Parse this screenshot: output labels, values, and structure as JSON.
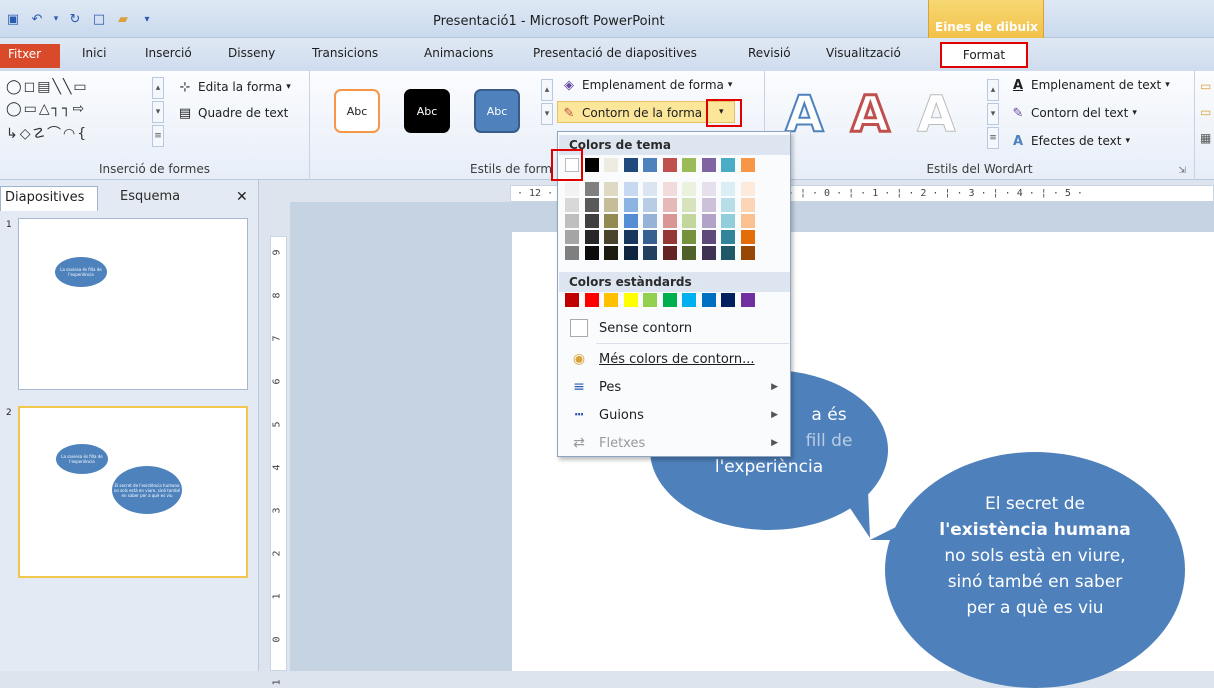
{
  "window": {
    "title": "Presentació1 - Microsoft PowerPoint",
    "context_tab_label": "Eines de dibuix"
  },
  "tabs": [
    {
      "label": "Fitxer"
    },
    {
      "label": "Inici"
    },
    {
      "label": "Inserció"
    },
    {
      "label": "Disseny"
    },
    {
      "label": "Transicions"
    },
    {
      "label": "Animacions"
    },
    {
      "label": "Presentació de diapositives"
    },
    {
      "label": "Revisió"
    },
    {
      "label": "Visualització"
    },
    {
      "label": "Format"
    }
  ],
  "ribbon": {
    "insert_shapes": {
      "edit_shape": "Edita la forma",
      "text_box": "Quadre de text",
      "group_label": "Inserció de formes"
    },
    "shape_styles": {
      "style_samples": [
        "Abc",
        "Abc",
        "Abc"
      ],
      "shape_fill": "Emplenament de forma",
      "shape_outline": "Contorn de la forma",
      "group_label": "Estils de form"
    },
    "wordart": {
      "text_fill": "Emplenament de text",
      "text_outline": "Contorn del text",
      "text_effects": "Efectes de text",
      "group_label": "Estils del WordArt",
      "sample_letter": "A"
    }
  },
  "slides_pane": {
    "tab_slides": "Diapositives",
    "tab_outline": "Esquema",
    "thumb1_bubble": "La saviesa és filla de l'experiència",
    "thumb2_bubble1": "La saviesa és filla de l'experiència",
    "thumb2_bubble2": "El secret de l'existència humana no sols està en viure, sinó també en saber per a què es viu"
  },
  "ruler": {
    "horizontal": "· 12 · ¦ · 5 · ¦ · 4 · ¦ · 3 · ¦ · 2 · ¦ · 1 · ¦ · 0 · ¦ · 1 · ¦ · 2 · ¦ · 3 · ¦ · 4 · ¦ · 5 ·",
    "vertical": [
      "9",
      "8",
      "7",
      "6",
      "5",
      "4",
      "3",
      "2",
      "1",
      "0",
      "1"
    ]
  },
  "slide": {
    "bubble1_visible_1": "a és",
    "bubble1_visible_2": "fill de",
    "bubble1_visible_3": "l'experiència",
    "bubble2_line1": "El secret de",
    "bubble2_line2": "l'existència humana",
    "bubble2_line3": "no sols està en viure,",
    "bubble2_line4": "sinó també en saber",
    "bubble2_line5": "per a què es viu"
  },
  "outline_menu": {
    "theme_colors_header": "Colors de tema",
    "standard_colors_header": "Colors estàndards",
    "no_outline": "Sense contorn",
    "more_colors": "Més colors de contorn...",
    "weight": "Pes",
    "dashes": "Guions",
    "arrows": "Fletxes",
    "theme_colors": [
      "#ffffff",
      "#000000",
      "#eeece1",
      "#1f497d",
      "#4f81bd",
      "#c0504d",
      "#9bbb59",
      "#8064a2",
      "#4bacc6",
      "#f79646"
    ],
    "theme_shades": [
      [
        "#f2f2f2",
        "#7f7f7f",
        "#ddd9c3",
        "#c6d9f0",
        "#dbe5f1",
        "#f2dcdb",
        "#ebf1dd",
        "#e5e0ec",
        "#dbeef3",
        "#fdeada"
      ],
      [
        "#d8d8d8",
        "#595959",
        "#c4bd97",
        "#8db3e2",
        "#b8cce4",
        "#e5b9b7",
        "#d7e3bc",
        "#ccc1d9",
        "#b7dde8",
        "#fbd5b5"
      ],
      [
        "#bfbfbf",
        "#3f3f3f",
        "#938953",
        "#548dd4",
        "#95b3d7",
        "#d99694",
        "#c3d69b",
        "#b2a2c7",
        "#92cddc",
        "#fac08f"
      ],
      [
        "#a5a5a5",
        "#262626",
        "#494429",
        "#17365d",
        "#366092",
        "#953734",
        "#76923c",
        "#5f497a",
        "#31859b",
        "#e36c09"
      ],
      [
        "#7f7f7f",
        "#0c0c0c",
        "#1d1b10",
        "#0f243e",
        "#244061",
        "#632423",
        "#4f6128",
        "#3f3151",
        "#205867",
        "#974806"
      ]
    ],
    "standard_colors": [
      "#c00000",
      "#ff0000",
      "#ffc000",
      "#ffff00",
      "#92d050",
      "#00b050",
      "#00b0f0",
      "#0070c0",
      "#002060",
      "#7030a0"
    ]
  },
  "colors": {
    "accent_blue": "#4e80bb",
    "highlight_red": "#e00000",
    "file_tab": "#d94a2b"
  }
}
